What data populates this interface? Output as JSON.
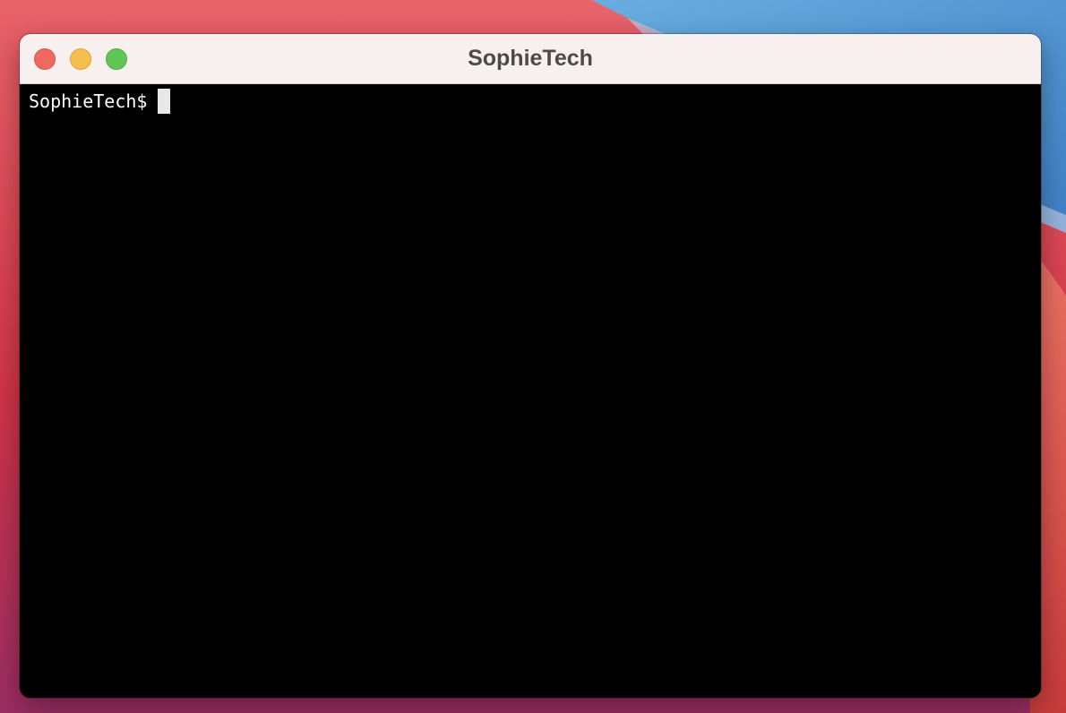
{
  "window": {
    "title": "SophieTech",
    "controls": {
      "close": {
        "icon": "close-icon",
        "color": "#ee6a5f"
      },
      "minimize": {
        "icon": "minimize-icon",
        "color": "#f5be4f"
      },
      "zoom": {
        "icon": "zoom-icon",
        "color": "#62c655"
      }
    }
  },
  "terminal": {
    "prompt": "SophieTech$",
    "input": "",
    "background": "#000000",
    "foreground": "#ffffff",
    "cursor_color": "#e8e8e8"
  },
  "colors": {
    "titlebar": "#f8efef",
    "wallpaper_primary": "#d8384e",
    "wallpaper_secondary": "#4f8fd0"
  }
}
